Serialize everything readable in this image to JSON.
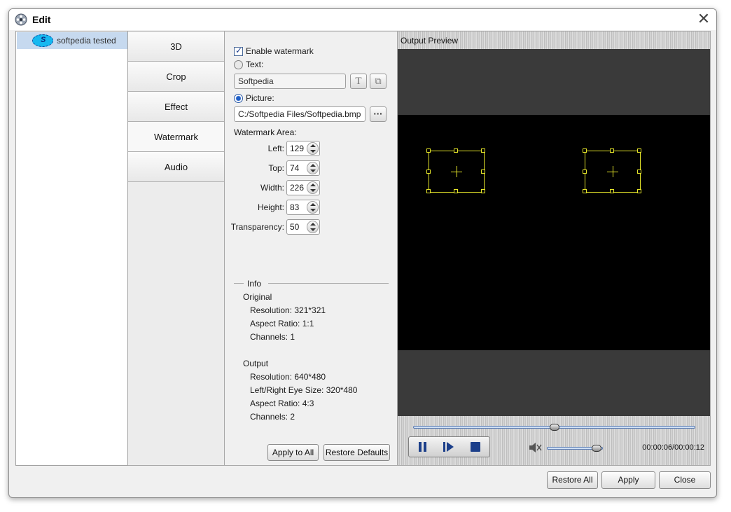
{
  "window": {
    "title": "Edit",
    "close_glyph": "✕"
  },
  "file_list": {
    "items": [
      {
        "name": "softpedia tested",
        "thumb_letter": "S"
      }
    ]
  },
  "tabs": [
    {
      "label": "3D",
      "active": false
    },
    {
      "label": "Crop",
      "active": false
    },
    {
      "label": "Effect",
      "active": false
    },
    {
      "label": "Watermark",
      "active": true
    },
    {
      "label": "Audio",
      "active": false
    }
  ],
  "watermark": {
    "enable_label": "Enable watermark",
    "enable_checked": true,
    "text_option_label": "Text:",
    "text_value": "Softpedia",
    "text_font_button_glyph": "T",
    "text_color_button_glyph": "⧉",
    "picture_option_label": "Picture:",
    "picture_selected": true,
    "picture_path": "C:/Softpedia Files/Softpedia.bmp",
    "browse_button_label": "···",
    "area_label": "Watermark Area:",
    "fields": [
      {
        "label": "Left:",
        "value": "129"
      },
      {
        "label": "Top:",
        "value": "74"
      },
      {
        "label": "Width:",
        "value": "226"
      },
      {
        "label": "Height:",
        "value": "83"
      },
      {
        "label": "Transparency:",
        "value": "50"
      }
    ]
  },
  "info": {
    "heading": "Info",
    "original_heading": "Original",
    "original": [
      "Resolution: 321*321",
      "Aspect Ratio: 1:1",
      "Channels: 1"
    ],
    "output_heading": "Output",
    "output": [
      "Resolution: 640*480",
      "Left/Right Eye Size: 320*480",
      "Aspect Ratio: 4:3",
      "Channels: 2"
    ]
  },
  "settings_buttons": {
    "apply_to_all": "Apply to All",
    "restore_defaults": "Restore Defaults"
  },
  "preview": {
    "label": "Output Preview",
    "seek_progress": 0.5,
    "volume_level": 0.9,
    "time": "00:00:06/00:00:12",
    "watermark_color": "#e6e62a"
  },
  "footer": {
    "restore_all": "Restore All",
    "apply": "Apply",
    "close": "Close"
  }
}
